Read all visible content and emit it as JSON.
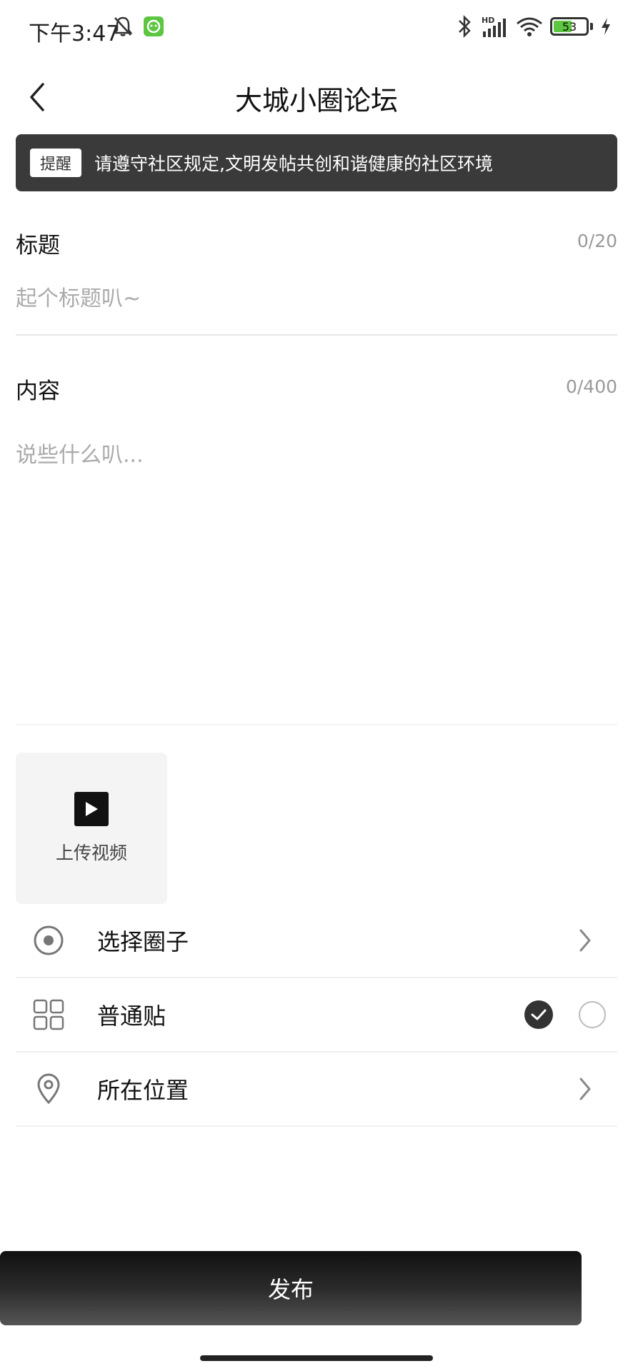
{
  "status_bar": {
    "time": "下午3:47",
    "battery_level": "53",
    "battery_fraction": 0.53
  },
  "header": {
    "title": "大城小圈论坛"
  },
  "notice": {
    "badge": "提醒",
    "text": "请遵守社区规定,文明发帖共创和谐健康的社区环境"
  },
  "title_field": {
    "label": "标题",
    "counter": "0/20",
    "placeholder": "起个标题叭~",
    "value": ""
  },
  "content_field": {
    "label": "内容",
    "counter": "0/400",
    "placeholder": "说些什么叭...",
    "value": ""
  },
  "upload": {
    "label": "上传视频",
    "icon": "play-icon"
  },
  "options": [
    {
      "label": "选择圈子",
      "icon": "target-icon"
    },
    {
      "label": "普通贴",
      "icon": "grid-icon",
      "checked": true
    },
    {
      "label": "所在位置",
      "icon": "location-pin-icon"
    }
  ],
  "publish": {
    "label": "发布"
  },
  "colors": {
    "notice_bg": "#3a3a3a",
    "battery": "#5cc640",
    "app_badge": "#5cc640"
  }
}
